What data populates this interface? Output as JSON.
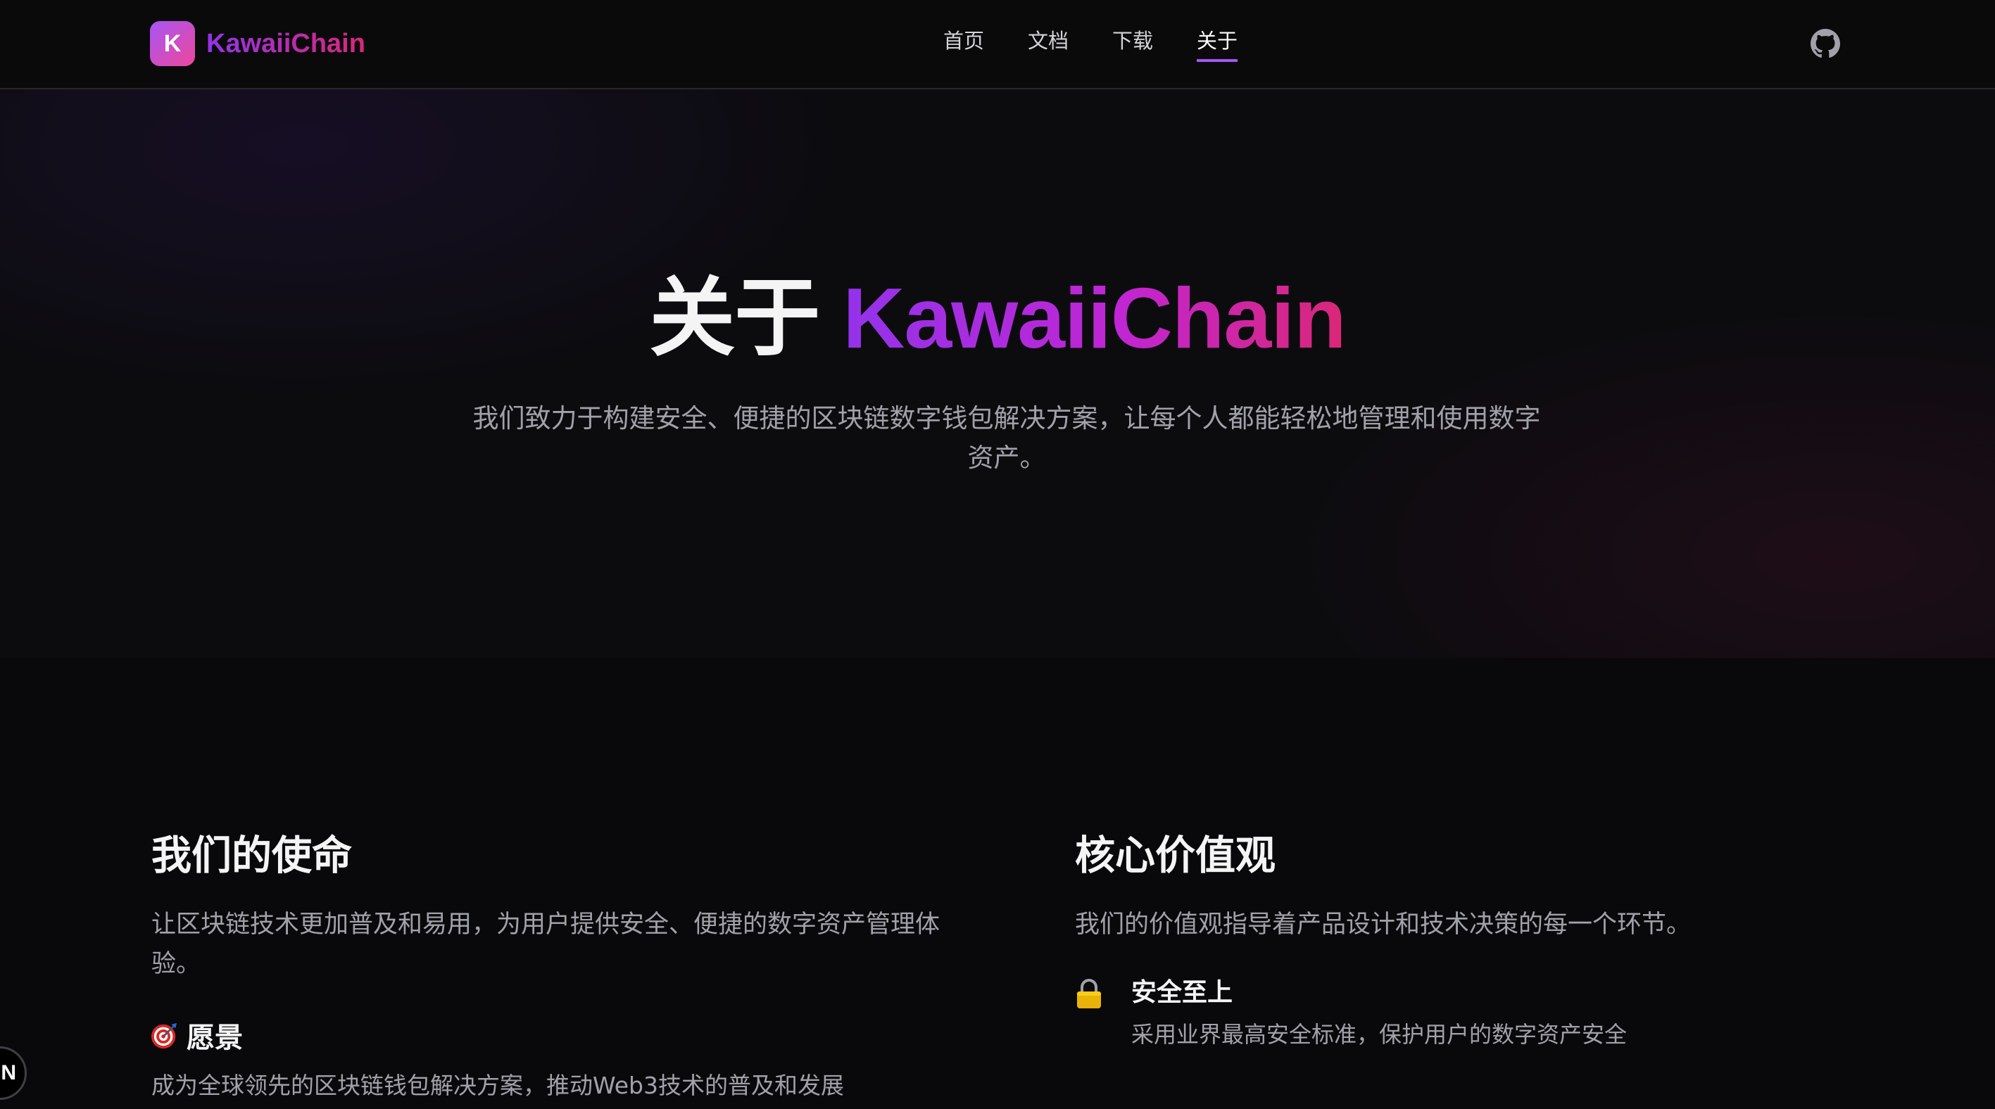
{
  "brand": {
    "logo_letter": "K",
    "name": "KawaiiChain"
  },
  "nav": {
    "items": [
      {
        "label": "首页"
      },
      {
        "label": "文档"
      },
      {
        "label": "下载"
      },
      {
        "label": "关于"
      }
    ],
    "active": "关于",
    "github_icon": "github-icon"
  },
  "hero": {
    "title_prefix": "关于 ",
    "title_brand": "KawaiiChain",
    "subtitle": "我们致力于构建安全、便捷的区块链数字钱包解决方案，让每个人都能轻松地管理和使用数字资产。"
  },
  "mission": {
    "title": "我们的使命",
    "description": "让区块链技术更加普及和易用，为用户提供安全、便捷的数字资产管理体验。",
    "vision": {
      "icon": "target-icon",
      "title": "愿景",
      "description": "成为全球领先的区块链钱包解决方案，推动Web3技术的普及和发展"
    }
  },
  "values": {
    "title": "核心价值观",
    "description": "我们的价值观指导着产品设计和技术决策的每一个环节。",
    "items": [
      {
        "icon": "lock-icon",
        "title": "安全至上",
        "description": "采用业界最高安全标准，保护用户的数字资产安全"
      }
    ]
  },
  "floating_button": {
    "label": "N"
  },
  "colors": {
    "accent_purple": "#9333ea",
    "accent_pink": "#db2777",
    "background": "#09090b"
  }
}
